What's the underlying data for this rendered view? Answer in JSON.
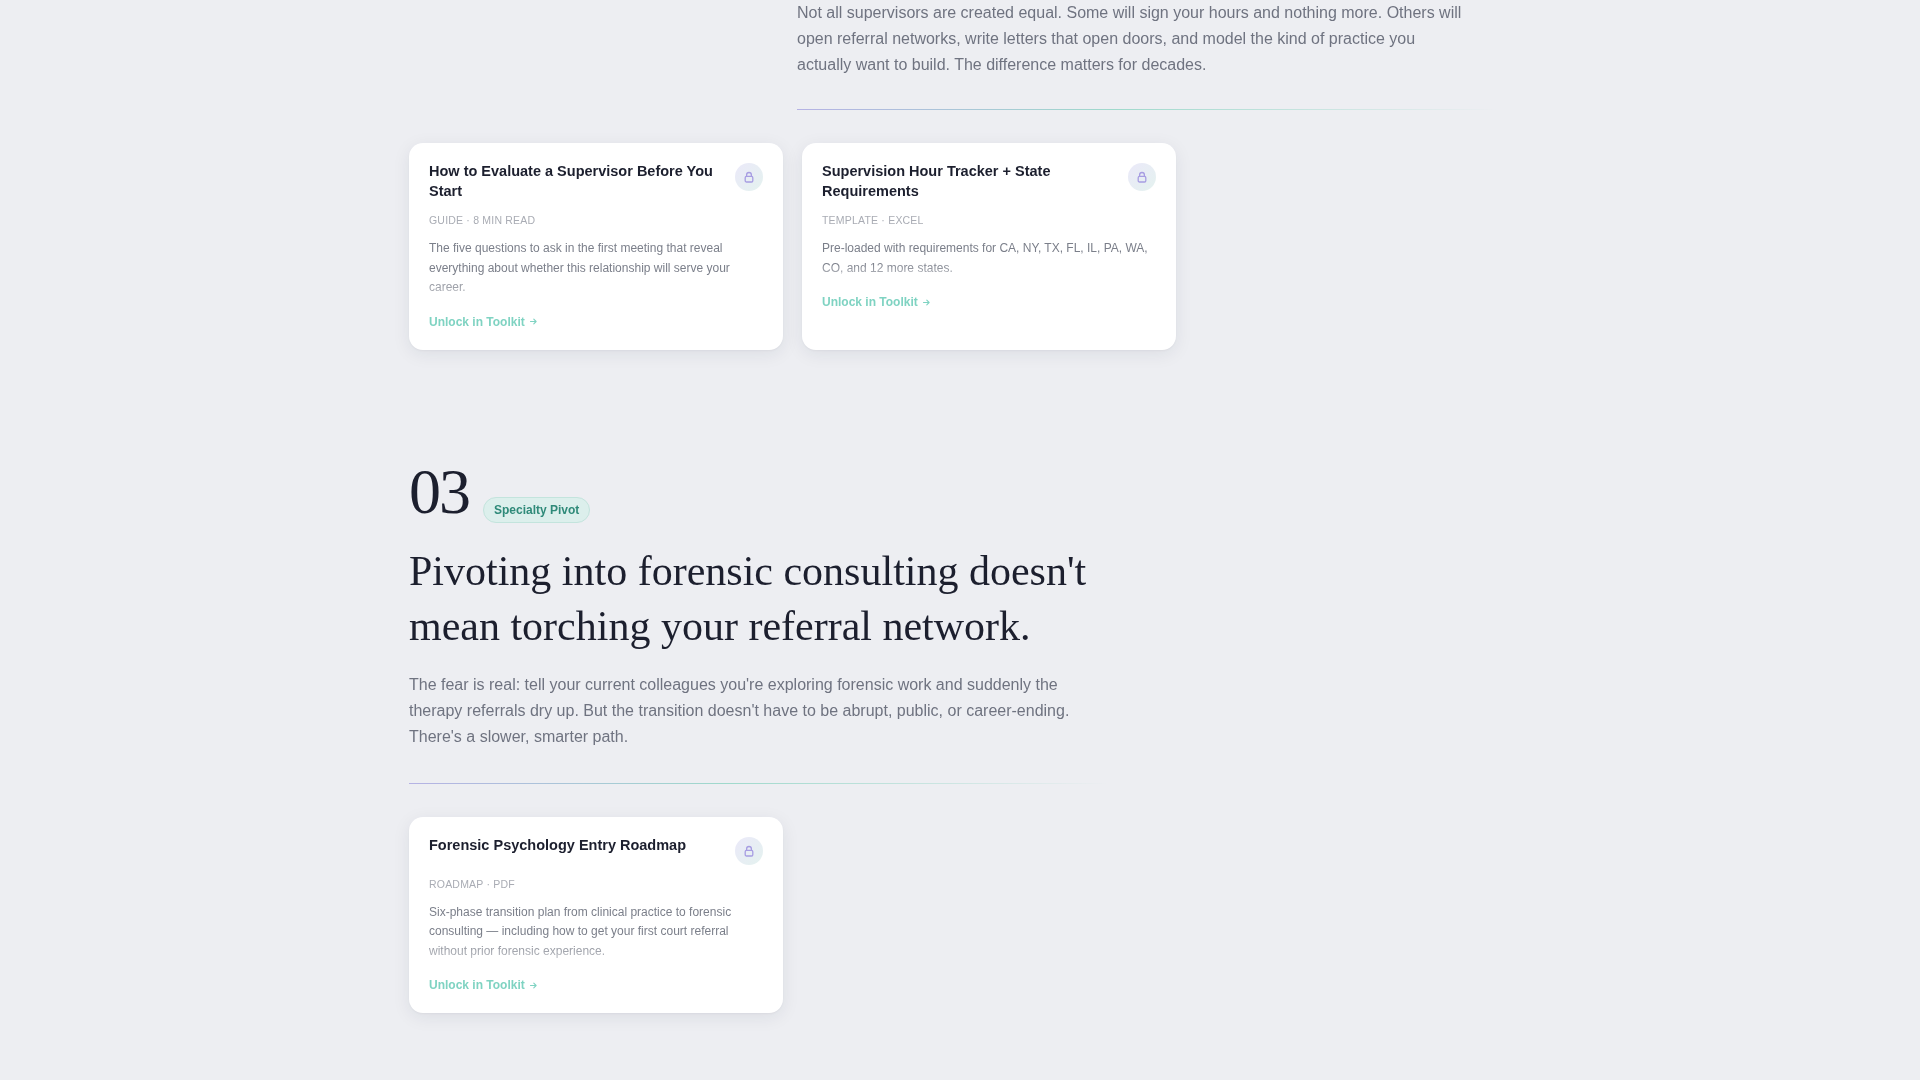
{
  "intro": {
    "text": "Not all supervisors are created equal. Some will sign your hours and nothing more. Others will open referral networks, write letters that open doors, and model the kind of practice you actually want to build. The difference matters for decades."
  },
  "intro_resources": [
    {
      "title": "How to Evaluate a Supervisor Before You Start",
      "meta": "GUIDE · 8 MIN READ",
      "description": "The five questions to ask in the first meeting that reveal everything about whether this relationship will serve your career.",
      "link": "Unlock in Toolkit"
    },
    {
      "title": "Supervision Hour Tracker + State Requirements",
      "meta": "TEMPLATE · EXCEL",
      "description": "Pre-loaded with requirements for CA, NY, TX, FL, IL, PA, WA, CO, and 12 more states.",
      "link": "Unlock in Toolkit"
    }
  ],
  "section": {
    "number": "03",
    "badge": "Specialty Pivot",
    "heading": "Pivoting into forensic consulting doesn't mean torching your referral network.",
    "text": "The fear is real: tell your current colleagues you're exploring forensic work and suddenly the therapy referrals dry up. But the transition doesn't have to be abrupt, public, or career-ending. There's a slower, smarter path.",
    "resources": [
      {
        "title": "Forensic Psychology Entry Roadmap",
        "meta": "ROADMAP · PDF",
        "description": "Six-phase transition plan from clinical practice to forensic consulting — including how to get your first court referral without prior forensic experience.",
        "link": "Unlock in Toolkit"
      }
    ]
  }
}
